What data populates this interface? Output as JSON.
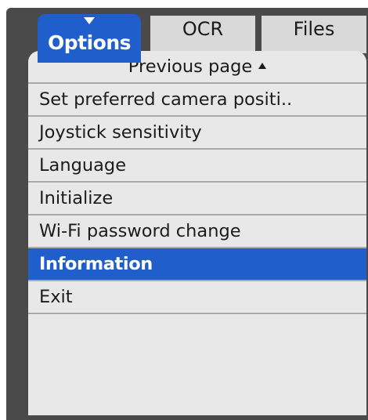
{
  "tabs": {
    "options": "Options",
    "ocr": "OCR",
    "files": "Files"
  },
  "menu": {
    "previous_page": "Previous page",
    "items": [
      "Set preferred camera positi..",
      "Joystick sensitivity",
      "Language",
      "Initialize",
      "Wi-Fi password change",
      "Information",
      "Exit"
    ],
    "selected_index": 5
  },
  "colors": {
    "accent": "#1f5ecb",
    "panel": "#e8e8e8",
    "bezel": "#4a4a4a",
    "tab_inactive": "#d9d9d9"
  },
  "icons": {
    "options_tab_indicator": "triangle-down-icon",
    "previous_page_indicator": "triangle-up-icon"
  }
}
